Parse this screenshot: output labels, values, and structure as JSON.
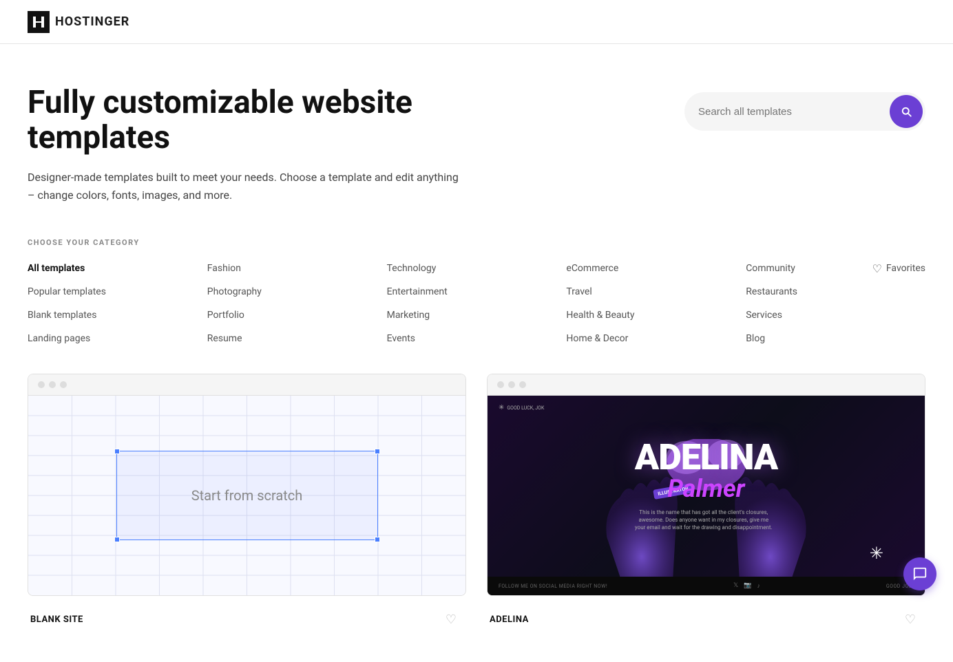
{
  "header": {
    "logo_text": "HOSTINGER"
  },
  "hero": {
    "title": "Fully customizable website templates",
    "description": "Designer-made templates built to meet your needs. Choose a template and edit anything – change colors, fonts, images, and more.",
    "search_placeholder": "Search all templates",
    "search_button_label": "Search"
  },
  "categories": {
    "label": "CHOOSE YOUR CATEGORY",
    "items": [
      {
        "id": "all-templates",
        "label": "All templates",
        "active": true,
        "col": 1
      },
      {
        "id": "fashion",
        "label": "Fashion",
        "active": false,
        "col": 2
      },
      {
        "id": "technology",
        "label": "Technology",
        "active": false,
        "col": 3
      },
      {
        "id": "ecommerce",
        "label": "eCommerce",
        "active": false,
        "col": 4
      },
      {
        "id": "community",
        "label": "Community",
        "active": false,
        "col": 5
      },
      {
        "id": "popular-templates",
        "label": "Popular templates",
        "active": false,
        "col": 1
      },
      {
        "id": "photography",
        "label": "Photography",
        "active": false,
        "col": 2
      },
      {
        "id": "entertainment",
        "label": "Entertainment",
        "active": false,
        "col": 3
      },
      {
        "id": "travel",
        "label": "Travel",
        "active": false,
        "col": 4
      },
      {
        "id": "restaurants",
        "label": "Restaurants",
        "active": false,
        "col": 5
      },
      {
        "id": "blank-templates",
        "label": "Blank templates",
        "active": false,
        "col": 1
      },
      {
        "id": "portfolio",
        "label": "Portfolio",
        "active": false,
        "col": 2
      },
      {
        "id": "marketing",
        "label": "Marketing",
        "active": false,
        "col": 3
      },
      {
        "id": "health-beauty",
        "label": "Health & Beauty",
        "active": false,
        "col": 4
      },
      {
        "id": "services",
        "label": "Services",
        "active": false,
        "col": 5
      },
      {
        "id": "landing-pages",
        "label": "Landing pages",
        "active": false,
        "col": 1
      },
      {
        "id": "resume",
        "label": "Resume",
        "active": false,
        "col": 2
      },
      {
        "id": "events",
        "label": "Events",
        "active": false,
        "col": 3
      },
      {
        "id": "home-decor",
        "label": "Home & Decor",
        "active": false,
        "col": 4
      },
      {
        "id": "blog",
        "label": "Blog",
        "active": false,
        "col": 5
      }
    ],
    "favorites_label": "Favorites"
  },
  "templates": [
    {
      "id": "blank-site",
      "name": "BLANK SITE",
      "type": "blank",
      "scratch_text": "Start from scratch"
    },
    {
      "id": "adelina",
      "name": "ADELINA",
      "type": "adelina",
      "main_name": "ADELINA",
      "sub_name": "Palmer",
      "badge": "ILLUSTRATOR",
      "footer_text": "FOLLOW ME ON SOCIAL MEDIA RIGHT NOW!",
      "footer_right": "GOOD JOB!",
      "good_luck": "GOOD LUCK, JOK",
      "small_text": "This is the name that has got all the client's closures, awesome. Does anyone want in my closures, give me your email and wait for the drawing and disappointment."
    }
  ],
  "chat": {
    "label": "Chat support"
  },
  "colors": {
    "accent": "#6b3fd4",
    "text_primary": "#111111",
    "text_secondary": "#555555",
    "border": "#e5e5e5"
  }
}
